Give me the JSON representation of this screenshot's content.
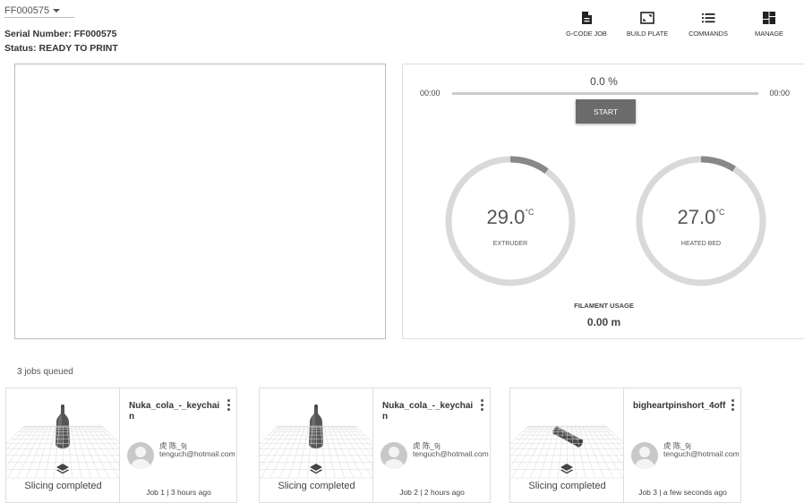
{
  "printer": {
    "name": "FF000575",
    "serial": "Serial Number: FF000575",
    "status": "Status: READY TO PRINT"
  },
  "toolbar": [
    {
      "label": "G-CODE JOB",
      "icon": "file-icon"
    },
    {
      "label": "BUILD PLATE",
      "icon": "build-plate-icon"
    },
    {
      "label": "COMMANDS",
      "icon": "list-icon"
    },
    {
      "label": "MANAGE",
      "icon": "dashboard-icon"
    }
  ],
  "progress": {
    "percent_text": "0.0 %",
    "fraction": 0,
    "elapsed": "00:00",
    "remaining": "00:00",
    "start_label": "START"
  },
  "gauges": [
    {
      "value": "29.0",
      "unit": "°C",
      "label": "EXTRUDER",
      "fraction": 0.1
    },
    {
      "value": "27.0",
      "unit": "°C",
      "label": "HEATED BED",
      "fraction": 0.09
    }
  ],
  "filament": {
    "title": "FILAMENT USAGE",
    "value": "0.00 m"
  },
  "queue": {
    "count_text": "3 jobs queued",
    "jobs": [
      {
        "title": "Nuka_cola_-_keychain",
        "user_name": "虎 陈_9j",
        "user_email": "tenguch@hotmail.com",
        "status": "Slicing completed",
        "meta": "Job 1 | 3 hours ago",
        "model": "bottle"
      },
      {
        "title": "Nuka_cola_-_keychain",
        "user_name": "虎 陈_9j",
        "user_email": "tenguch@hotmail.com",
        "status": "Slicing completed",
        "meta": "Job 2 | 2 hours ago",
        "model": "bottle"
      },
      {
        "title": "bigheartpinshort_4off",
        "user_name": "虎 陈_9j",
        "user_email": "tenguch@hotmail.com",
        "status": "Slicing completed",
        "meta": "Job 3 | a few seconds ago",
        "model": "pin"
      }
    ]
  },
  "colors": {
    "gauge_track": "#d9d9d9",
    "gauge_fill": "#888888",
    "button": "#6b6b6b"
  }
}
